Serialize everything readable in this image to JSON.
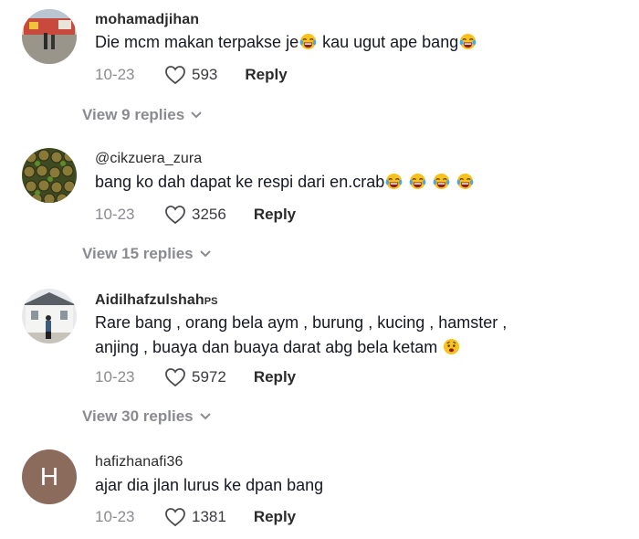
{
  "comments": [
    {
      "username": "mohamadjihan",
      "badge": "",
      "text_parts": [
        "Die mcm makan terpakse je",
        " kau ugut ape bang"
      ],
      "date": "10-23",
      "likes": "593",
      "reply_label": "Reply",
      "view_replies": "View 9 replies",
      "avatar_icon": "street-photo"
    },
    {
      "username": "@cikzuera_zura",
      "badge": "",
      "text_parts": [
        "bang ko dah dapat ke respi dari en.crab"
      ],
      "date": "10-23",
      "likes": "3256",
      "reply_label": "Reply",
      "view_replies": "View 15 replies",
      "avatar_icon": "food-photo"
    },
    {
      "username": "Aidilhafzulshah",
      "badge": "PS",
      "text_parts": [
        "Rare bang , orang bela aym , burung , kucing , hamster ,",
        "anjing , buaya dan buaya darat abg bela ketam "
      ],
      "date": "10-23",
      "likes": "5972",
      "reply_label": "Reply",
      "view_replies": "View 30 replies",
      "avatar_icon": "building-photo"
    },
    {
      "username": "hafizhanafi36",
      "badge": "",
      "avatar_letter": "H",
      "text_parts": [
        "ajar dia jlan lurus ke dpan bang"
      ],
      "date": "10-23",
      "likes": "1381",
      "reply_label": "Reply",
      "avatar_icon": "letter-avatar"
    }
  ],
  "icons": {
    "like": "heart-outline-icon",
    "expand": "chevron-down-icon",
    "laugh_emoji": "tears-of-joy-emoji",
    "sad_emoji": "worried-face-emoji"
  },
  "colors": {
    "text": "#161823",
    "secondary": "#8a8b91",
    "avatar_letter_bg": "#8a6b5c"
  }
}
